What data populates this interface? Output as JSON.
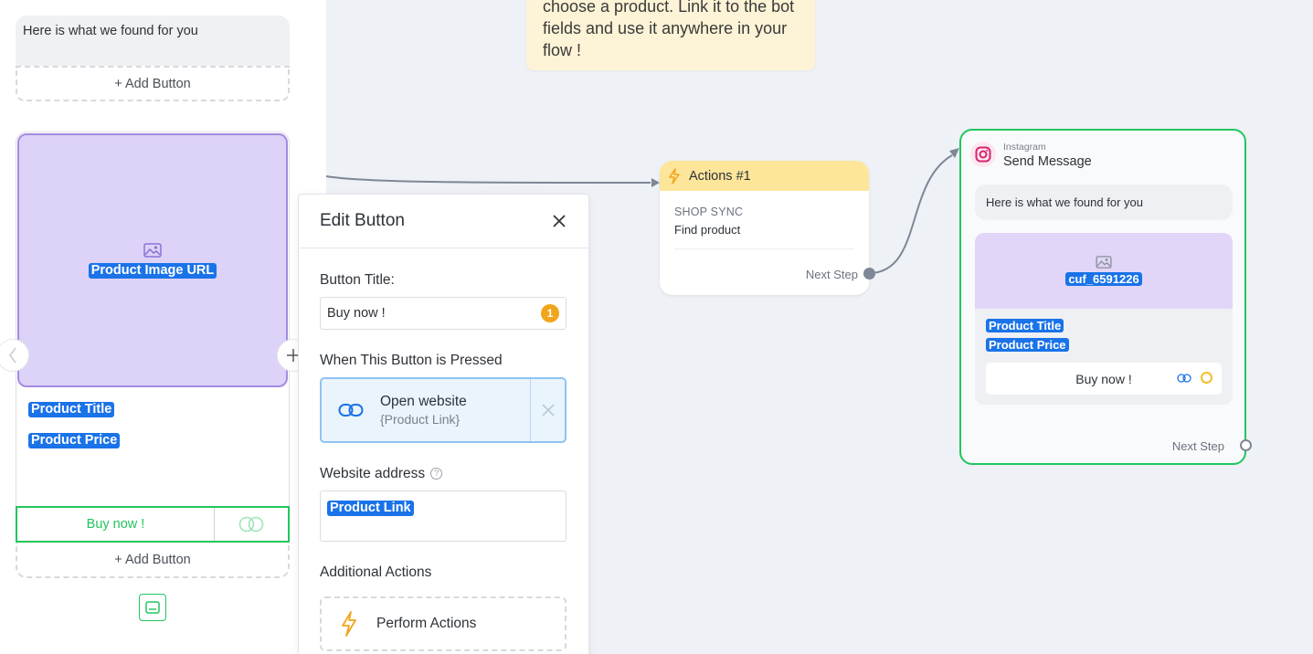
{
  "left_panel": {
    "message_text": "Here is what we found for you",
    "add_button_label": "+ Add Button",
    "card": {
      "image_tag": "Product Image URL",
      "title_tag": "Product Title",
      "price_tag": "Product Price",
      "button_label": "Buy now !"
    },
    "add_button_label_2": "+ Add Button",
    "prev_icon": "chevron-left-icon",
    "next_icon": "plus-icon"
  },
  "note": {
    "text": "choose a product. Link it to the bot fields and use it anywhere in your flow !"
  },
  "edit_panel": {
    "title": "Edit Button",
    "button_title_label": "Button Title:",
    "button_title_value": "Buy now !",
    "char_badge": "1",
    "pressed_label": "When This Button is Pressed",
    "action": {
      "name": "Open website",
      "sub": "{Product Link}"
    },
    "website_label": "Website address",
    "website_tag": "Product Link",
    "additional_label": "Additional Actions",
    "perform_label": "Perform Actions"
  },
  "actions_node": {
    "title": "Actions #1",
    "category": "SHOP SYNC",
    "action": "Find product",
    "next_step": "Next Step"
  },
  "ig_node": {
    "platform": "Instagram",
    "title": "Send Message",
    "message_text": "Here is what we found for you",
    "image_tag": "cuf_6591226",
    "title_tag": "Product Title",
    "price_tag": "Product Price",
    "button_label": "Buy now !",
    "next_step": "Next Step"
  },
  "colors": {
    "accent_green": "#22c55e",
    "tag_blue": "#1a73e8",
    "card_purple": "#ddd2f7",
    "actions_yellow": "#fde59a",
    "badge_orange": "#f0a51c"
  }
}
